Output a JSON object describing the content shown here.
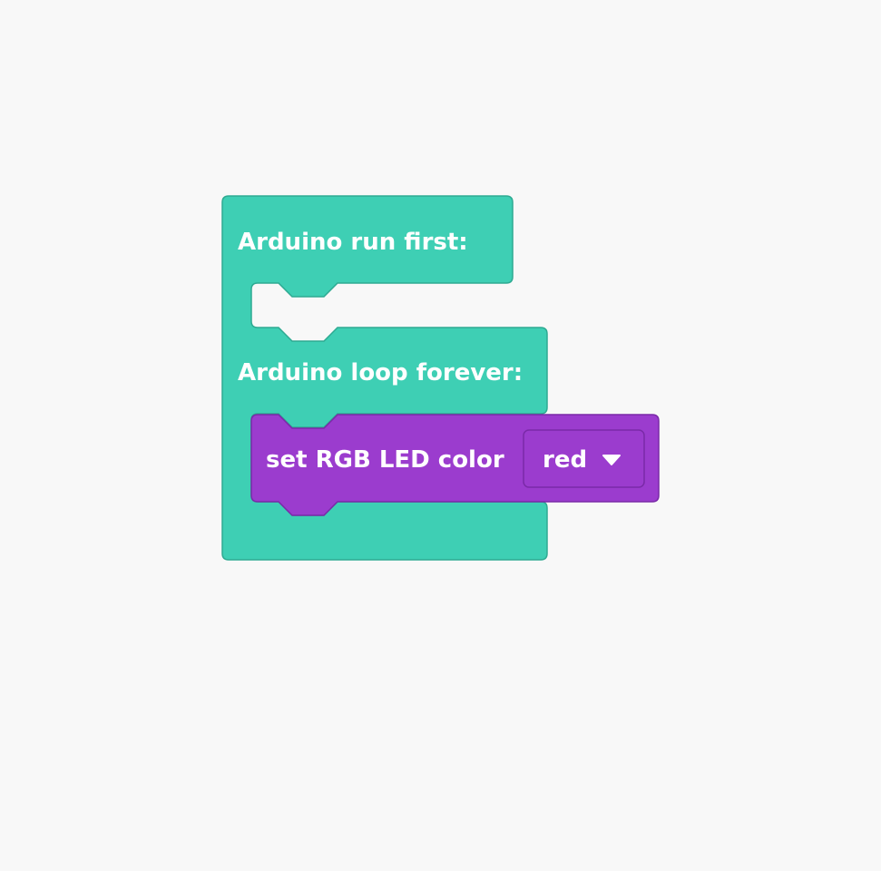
{
  "workspace": {
    "background": "#f8f8f8"
  },
  "arduino_block": {
    "setup_label": "Arduino run first:",
    "loop_label": "Arduino loop forever:",
    "fill": "#3ecfb4",
    "stroke": "#2eaa92"
  },
  "rgb_block": {
    "label": "set RGB LED color",
    "dropdown_value": "red",
    "dropdown_icon": "caret-down-icon",
    "fill": "#9b3cce",
    "stroke": "#7a2aa8"
  }
}
